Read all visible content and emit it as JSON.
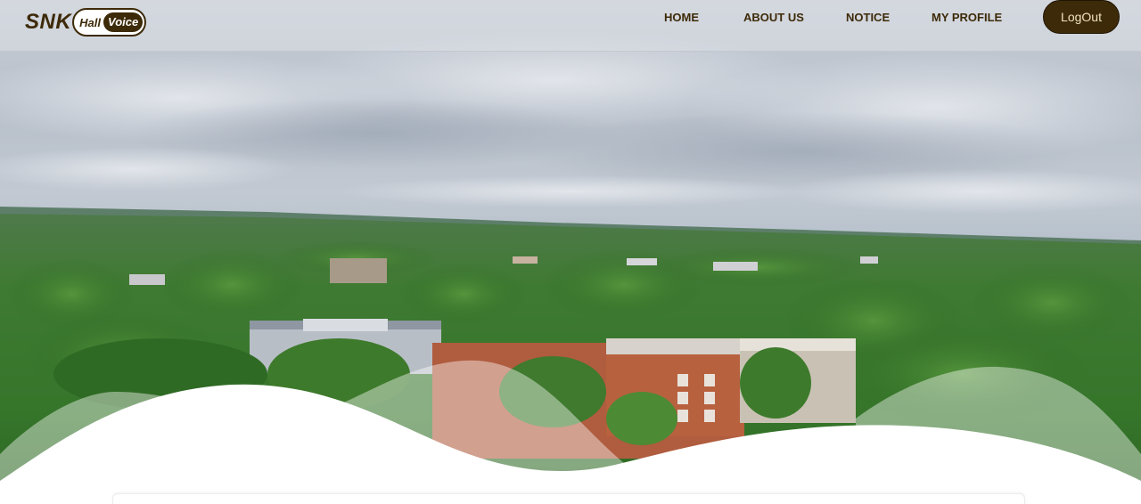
{
  "brand": {
    "prefix": "SNK",
    "hall": "Hall",
    "voice": "Voice"
  },
  "nav": {
    "items": [
      {
        "label": "HOME"
      },
      {
        "label": "ABOUT US"
      },
      {
        "label": "NOTICE"
      },
      {
        "label": "MY PROFILE"
      }
    ],
    "logout_label": "LogOut"
  },
  "colors": {
    "brand_dark": "#3d2a08",
    "nav_text": "#3d2a08",
    "logout_text": "#f0e2c0"
  },
  "hero": {
    "image_subject": "aerial-campus-photo"
  }
}
